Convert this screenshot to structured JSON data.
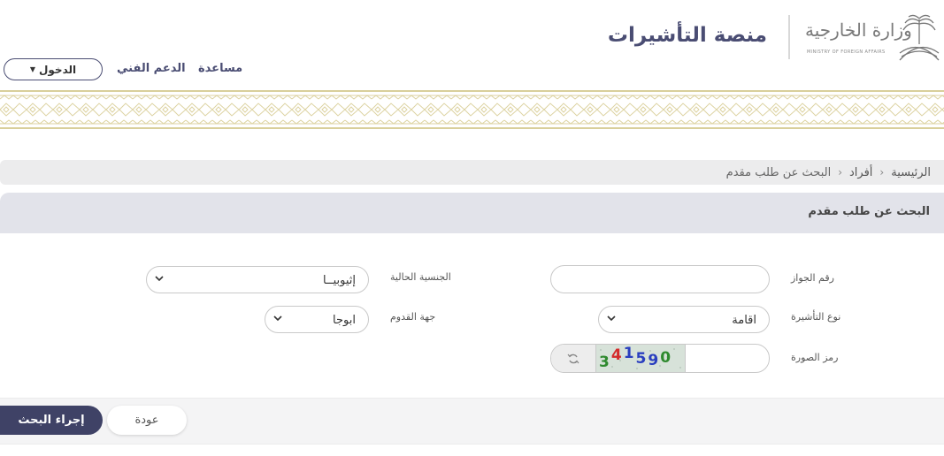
{
  "header": {
    "site_title": "منصة التأشيرات",
    "logo_arabic": "وزارة الخارجية",
    "logo_english": "MINISTRY OF FOREIGN AFFAIRS",
    "nav": {
      "help": "مساعدة",
      "support": "الدعم الفني"
    },
    "login_label": "الدخول"
  },
  "breadcrumb": {
    "home": "الرئيسية",
    "individuals": "أفراد",
    "current": "البحث عن طلب مقدم",
    "separator": "›"
  },
  "panel": {
    "title": "البحث عن طلب مقدم"
  },
  "form": {
    "passport_number": {
      "label": "رقم الجواز",
      "value": ""
    },
    "current_nationality": {
      "label": "الجنسية الحالية",
      "value": "إثيوبيــا"
    },
    "visa_type": {
      "label": "نوع التأشيرة",
      "value": "اقامة"
    },
    "arrival_destination": {
      "label": "جهة القدوم",
      "value": "ابوجا"
    },
    "captcha": {
      "label": "رمز الصورة",
      "value": "",
      "digits": [
        {
          "char": "3",
          "color": "#2f8a2f"
        },
        {
          "char": "4",
          "color": "#d42a2a"
        },
        {
          "char": "1",
          "color": "#2a3fbf"
        },
        {
          "char": "5",
          "color": "#2a3fbf"
        },
        {
          "char": "9",
          "color": "#2a3fbf"
        },
        {
          "char": "0",
          "color": "#2f8a2f"
        }
      ]
    }
  },
  "actions": {
    "back": "عودة",
    "search": "إجراء البحث"
  },
  "colors": {
    "primary": "#3f4266",
    "panel": "#e2e3ea",
    "ornament": "#d9cf9b"
  },
  "icons": {
    "refresh": "refresh-icon",
    "dropdown": "chevron-down-icon",
    "emblem": "palm-swords-emblem-icon"
  }
}
